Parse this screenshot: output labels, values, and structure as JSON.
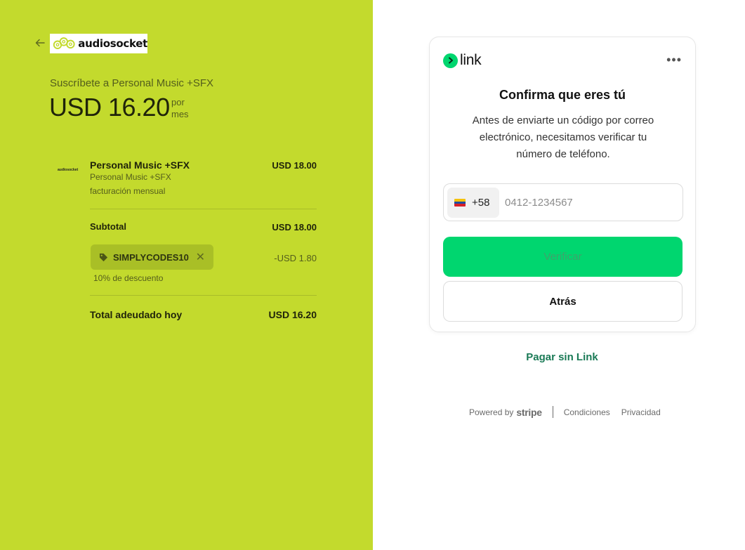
{
  "left": {
    "logo_text": "audiosocket",
    "subscribe_title": "Suscríbete a Personal Music +SFX",
    "price": "USD 16.20",
    "per_line1": "por",
    "per_line2": "mes",
    "item": {
      "thumb_text": "audiosocket",
      "name": "Personal Music +SFX",
      "price": "USD 18.00",
      "sub1": "Personal Music +SFX",
      "sub2": "facturación mensual"
    },
    "subtotal_label": "Subtotal",
    "subtotal_value": "USD 18.00",
    "promo_code": "SIMPLYCODES10",
    "discount_value": "-USD 1.80",
    "discount_note": "10% de descuento",
    "total_label": "Total adeudado hoy",
    "total_value": "USD 16.20"
  },
  "card": {
    "brand": "link",
    "title": "Confirma que eres tú",
    "description": "Antes de enviarte un código por correo electrónico, necesitamos verificar tu número de teléfono.",
    "country_code": "+58",
    "phone_placeholder": "0412-1234567",
    "phone_value": "",
    "verify_label": "Verificar",
    "back_label": "Atrás"
  },
  "pay_without_link": "Pagar sin Link",
  "footer": {
    "powered_by": "Powered by",
    "stripe": "stripe",
    "terms": "Condiciones",
    "privacy": "Privacidad"
  },
  "colors": {
    "left_bg": "#c3da2d",
    "link_green": "#00d66f",
    "link_text_green": "#1a7a56"
  }
}
